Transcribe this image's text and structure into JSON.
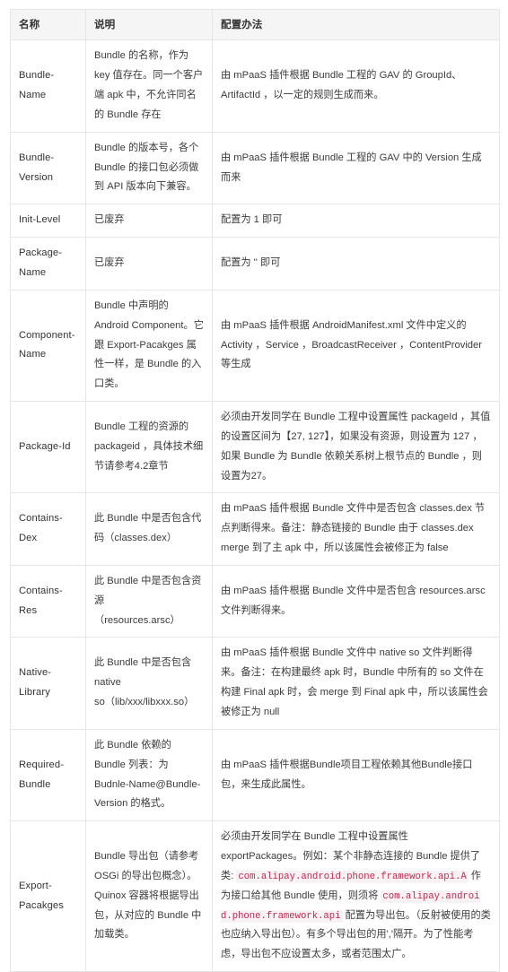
{
  "table": {
    "headers": [
      "名称",
      "说明",
      "配置办法"
    ],
    "rows": [
      {
        "name": "Bundle-Name",
        "desc": "Bundle 的名称，作为 key 值存在。同一个客户端 apk 中，不允许同名的 Bundle 存在",
        "conf": "由 mPaaS 插件根据 Bundle 工程的 GAV 的 GroupId、ArtifactId ，以一定的规则生成而来。"
      },
      {
        "name": "Bundle-Version",
        "desc": "Bundle 的版本号，各个 Bundle 的接口包必须做到 API 版本向下兼容。",
        "conf": "由 mPaaS 插件根据 Bundle 工程的 GAV 中的 Version 生成而来"
      },
      {
        "name": "Init-Level",
        "desc": "已废弃",
        "conf": "配置为 1 即可"
      },
      {
        "name": "Package-Name",
        "desc": "已废弃",
        "conf": "配置为 '' 即可"
      },
      {
        "name": "Component-Name",
        "desc": "Bundle 中声明的 Android Component。它跟 Export-Pacakges 属性一样，是 Bundle 的入口类。",
        "conf": "由 mPaaS 插件根据 AndroidManifest.xml 文件中定义的 Activity ，Service ，BroadcastReceiver ，ContentProvider 等生成"
      },
      {
        "name": "Package-Id",
        "desc": "Bundle 工程的资源的 packageid ，具体技术细节请参考4.2章节",
        "conf": "必须由开发同学在 Bundle 工程中设置属性 packageId ，其值的设置区间为【27, 127】，如果没有资源，则设置为 127 ，如果 Bundle 为 Bundle 依赖关系树上根节点的 Bundle ，则设置为27。"
      },
      {
        "name": "Contains-Dex",
        "desc": "此 Bundle 中是否包含代码（classes.dex）",
        "conf": "由 mPaaS 插件根据 Bundle 文件中是否包含 classes.dex 节点判断得来。备注：静态链接的 Bundle 由于 classes.dex merge 到了主 apk 中，所以该属性会被修正为 false"
      },
      {
        "name": "Contains-Res",
        "desc": "此 Bundle 中是否包含资源\n（resources.arsc）",
        "conf": "由 mPaaS 插件根据 Bundle 文件中是否包含 resources.arsc 文件判断得来。"
      },
      {
        "name": "Native-Library",
        "desc": "此 Bundle 中是否包含 native\nso（lib/xxx/libxxx.so）",
        "conf": "由 mPaaS 插件根据 Bundle 文件中 native so 文件判断得来。备注：在构建最终 apk 时，Bundle 中所有的 so 文件在构建 Final apk 时，会 merge 到 Final apk 中，所以该属性会被修正为 null"
      },
      {
        "name": "Required-Bundle",
        "desc": "此 Bundle 依赖的 Bundle 列表：为 Budnle-Name@Bundle-Version 的格式。",
        "conf": "由 mPaaS 插件根据Bundle项目工程依赖其他Bundle接口包，来生成此属性。"
      },
      {
        "name": "Export-Pacakges",
        "desc": "Bundle 导出包（请参考 OSGi 的导出包概念）。Quinox 容器将根据导出包，从对应的 Bundle 中加载类。",
        "conf_parts": [
          {
            "type": "text",
            "value": "必须由开发同学在 Bundle 工程中设置属性 exportPackages。例如：某个非静态连接的 Bundle 提供了类: "
          },
          {
            "type": "code",
            "value": "com.alipay.android.phone.framework.api.A"
          },
          {
            "type": "text",
            "value": " 作为接口给其他 Bundle 使用，则须将 "
          },
          {
            "type": "code",
            "value": "com.alipay.android.phone.framework.api"
          },
          {
            "type": "text",
            "value": " 配置为导出包。（反射被使用的类也应纳入导出包）。有多个导出包的用','隔开。为了性能考虑，导出包不应设置太多，或者范围太广。"
          }
        ]
      }
    ]
  },
  "colors": {
    "header_bg": "#f5f5f5",
    "border": "#e6e6e6",
    "text": "#333333",
    "code_text": "#c7254e",
    "code_bg": "#f9f2f4"
  }
}
